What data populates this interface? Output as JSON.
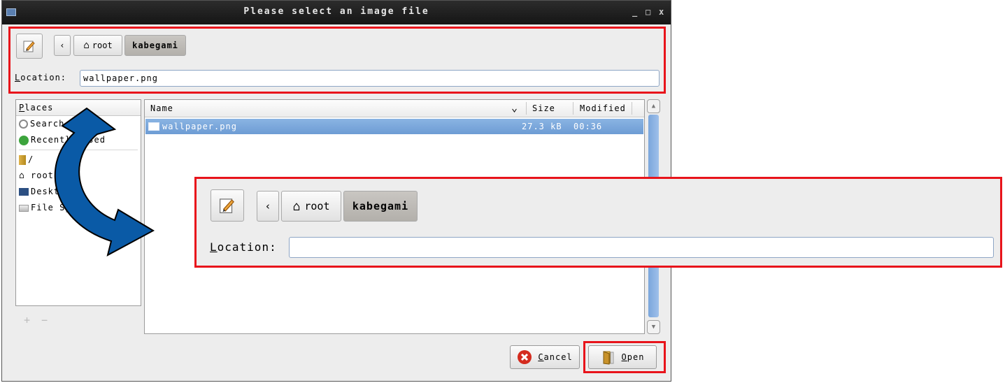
{
  "window": {
    "title": "Please select an image file",
    "controls": [
      "_",
      "□",
      "x"
    ]
  },
  "path_bar": {
    "back_label": "‹",
    "crumbs": [
      "root",
      "kabegami"
    ],
    "active_crumb": "kabegami"
  },
  "location": {
    "label_first": "L",
    "label_rest": "ocation:",
    "value": "wallpaper.png"
  },
  "places": {
    "header_first": "P",
    "header_rest": "laces",
    "items": [
      {
        "label": "Search",
        "icon": "search-icon"
      },
      {
        "label": "Recently Used",
        "icon": "recent-icon"
      },
      {
        "label": "/",
        "icon": "folder-icon"
      },
      {
        "label": "root",
        "icon": "home-icon"
      },
      {
        "label": "Desktop",
        "icon": "desktop-icon"
      },
      {
        "label": "File System",
        "icon": "drive-icon"
      }
    ],
    "footer": [
      "+",
      "−"
    ]
  },
  "file_list": {
    "columns": [
      "Name",
      "Size",
      "Modified"
    ],
    "sort_indicator": "⌄",
    "rows": [
      {
        "name": "wallpaper.png",
        "size": "27.3 kB",
        "modified": "00:36",
        "selected": true
      }
    ]
  },
  "buttons": {
    "cancel_first": "C",
    "cancel_rest": "ancel",
    "open_first": "O",
    "open_rest": "pen"
  },
  "zoom": {
    "back_label": "‹",
    "crumbs": [
      "root",
      "kabegami"
    ],
    "location_first": "L",
    "location_rest": "ocation:",
    "location_value": ""
  },
  "colors": {
    "highlight": "#e8141b",
    "selection": "#7aa7da",
    "arrow": "#0a5aa6"
  }
}
